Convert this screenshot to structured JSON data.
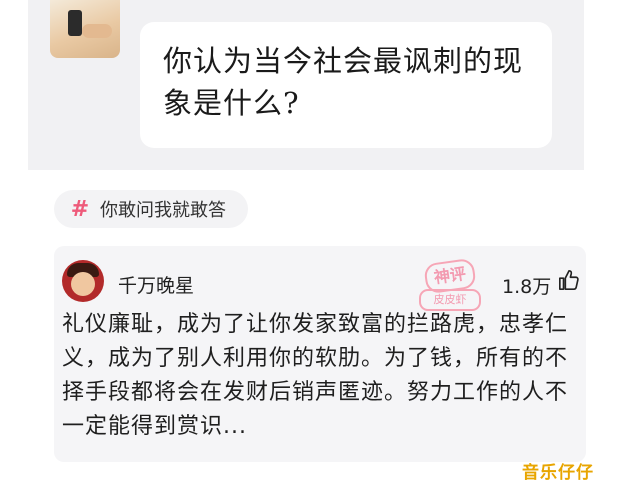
{
  "question": {
    "text": "你认为当今社会最讽刺的现象是什么?"
  },
  "topic": {
    "icon": "hash-icon",
    "label": "你敢问我就敢答"
  },
  "answer": {
    "author": "千万晚星",
    "award_main": "神评",
    "award_sub": "皮皮虾",
    "likes": "1.8万",
    "text": "礼仪廉耻，成为了让你发家致富的拦路虎，忠孝仁义，成为了别人利用你的软肋。为了钱，所有的不择手段都将会在发财后销声匿迹。努力工作的人不一定能得到赏识..."
  },
  "watermark": "音乐仔仔",
  "colors": {
    "accent": "#ee5a7a",
    "stamp": "#f39ab0",
    "watermark": "#e8a500"
  }
}
